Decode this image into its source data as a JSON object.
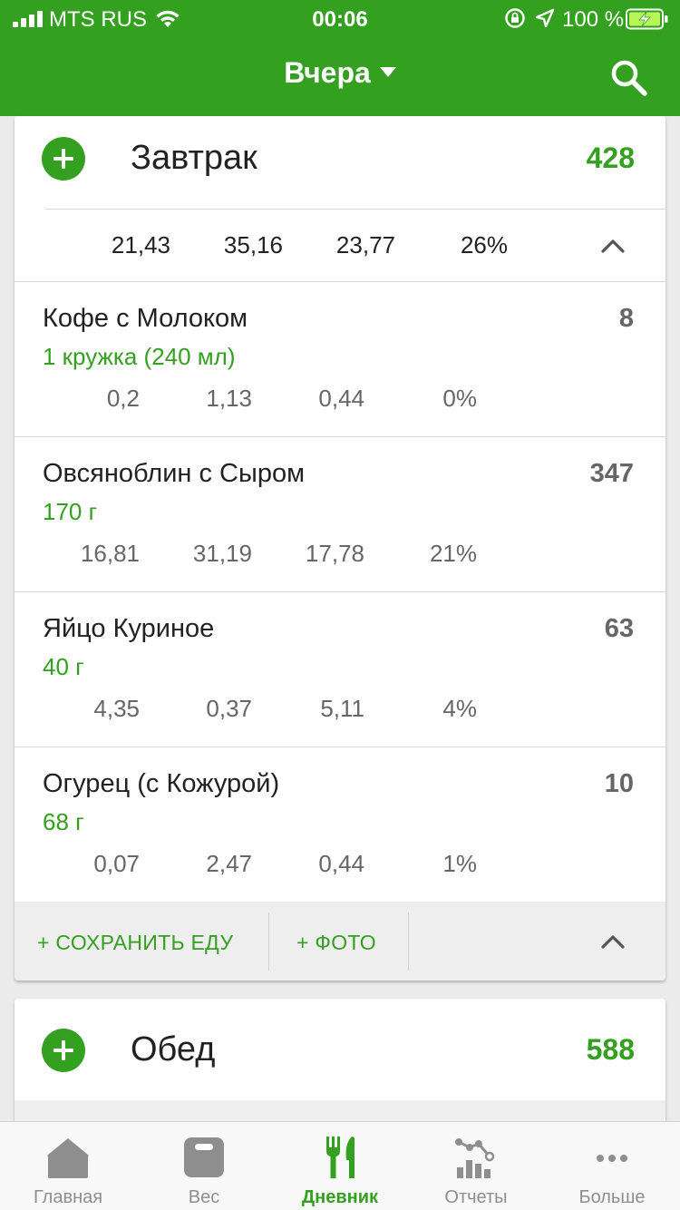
{
  "status": {
    "carrier": "MTS RUS",
    "time": "00:06",
    "battery": "100 %"
  },
  "nav": {
    "title": "Вчера",
    "icons": {
      "search": "search-icon",
      "dropdown": "caret-down-icon"
    }
  },
  "colors": {
    "accent": "#34a01f",
    "muted": "#666666"
  },
  "breakfast": {
    "name": "Завтрак",
    "calories": "428",
    "summary": [
      "21,43",
      "35,16",
      "23,77",
      "26%"
    ],
    "items": [
      {
        "name": "Кофе с Молоком",
        "portion": "1 кружка (240 мл)",
        "calories": "8",
        "nutrients": [
          "0,2",
          "1,13",
          "0,44",
          "0%"
        ]
      },
      {
        "name": "Овсяноблин с Сыром",
        "portion": "170 г",
        "calories": "347",
        "nutrients": [
          "16,81",
          "31,19",
          "17,78",
          "21%"
        ]
      },
      {
        "name": "Яйцо Куриное",
        "portion": "40 г",
        "calories": "63",
        "nutrients": [
          "4,35",
          "0,37",
          "5,11",
          "4%"
        ]
      },
      {
        "name": "Огурец (с Кожурой)",
        "portion": "68 г",
        "calories": "10",
        "nutrients": [
          "0,07",
          "2,47",
          "0,44",
          "1%"
        ]
      }
    ],
    "actions": {
      "save": "+ СОХРАНИТЬ ЕДУ",
      "photo": "+ ФОТО"
    }
  },
  "lunch": {
    "name": "Обед",
    "calories": "588"
  },
  "tabs": [
    {
      "label": "Главная",
      "icon": "home-icon"
    },
    {
      "label": "Вес",
      "icon": "scale-icon"
    },
    {
      "label": "Дневник",
      "icon": "fork-knife-icon",
      "active": true
    },
    {
      "label": "Отчеты",
      "icon": "chart-icon"
    },
    {
      "label": "Больше",
      "icon": "more-icon"
    }
  ]
}
